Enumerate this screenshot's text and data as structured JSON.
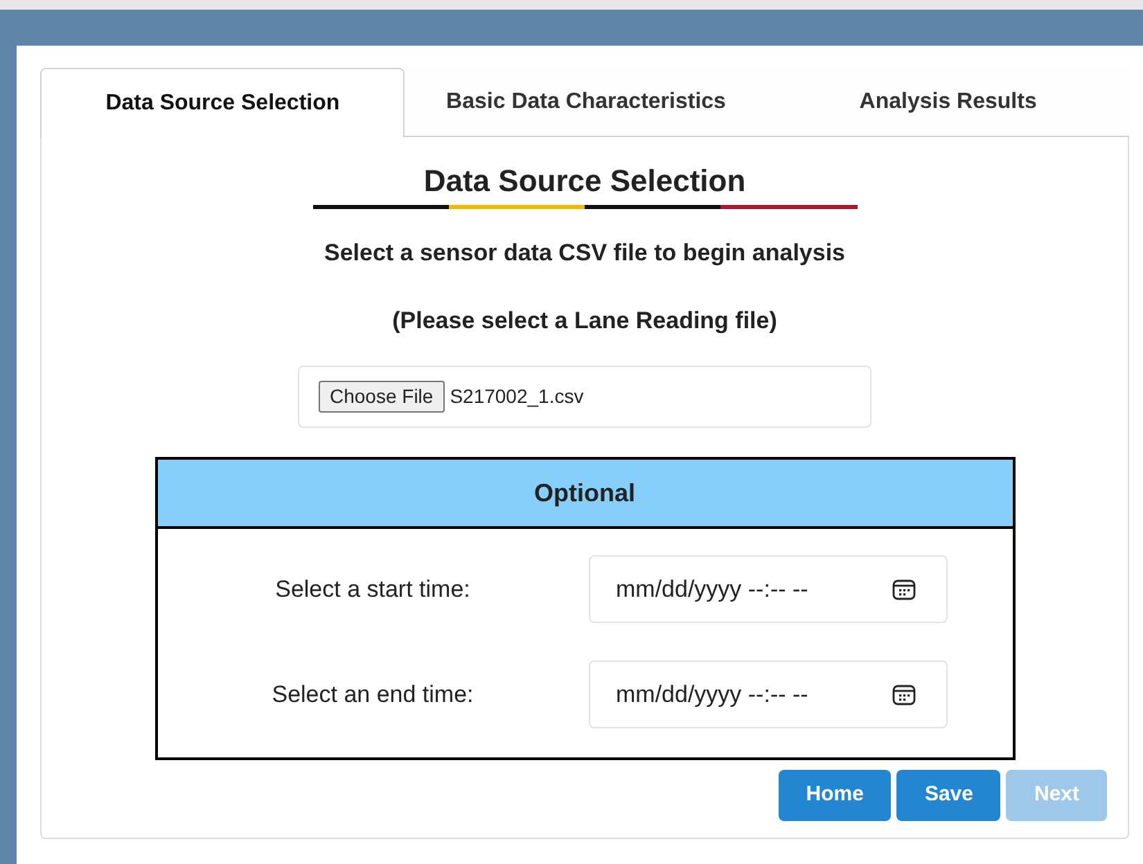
{
  "tabs": [
    {
      "label": "Data Source Selection",
      "selected": true
    },
    {
      "label": "Basic Data Characteristics",
      "selected": false
    },
    {
      "label": "Analysis Results",
      "selected": false
    }
  ],
  "heading": "Data Source Selection",
  "instructions": [
    "Select a sensor data CSV file to begin analysis",
    "(Please select a Lane Reading file)"
  ],
  "file_picker": {
    "button": "Choose File",
    "value": "S217002_1.csv"
  },
  "optional": {
    "title": "Optional",
    "fields": [
      {
        "label": "Select a start time:",
        "placeholder": "mm/dd/yyyy --:-- --"
      },
      {
        "label": "Select an end time:",
        "placeholder": "mm/dd/yyyy --:-- --"
      }
    ]
  },
  "buttons": [
    {
      "label": "Home",
      "disabled": false
    },
    {
      "label": "Save",
      "disabled": false
    },
    {
      "label": "Next",
      "disabled": true
    }
  ]
}
